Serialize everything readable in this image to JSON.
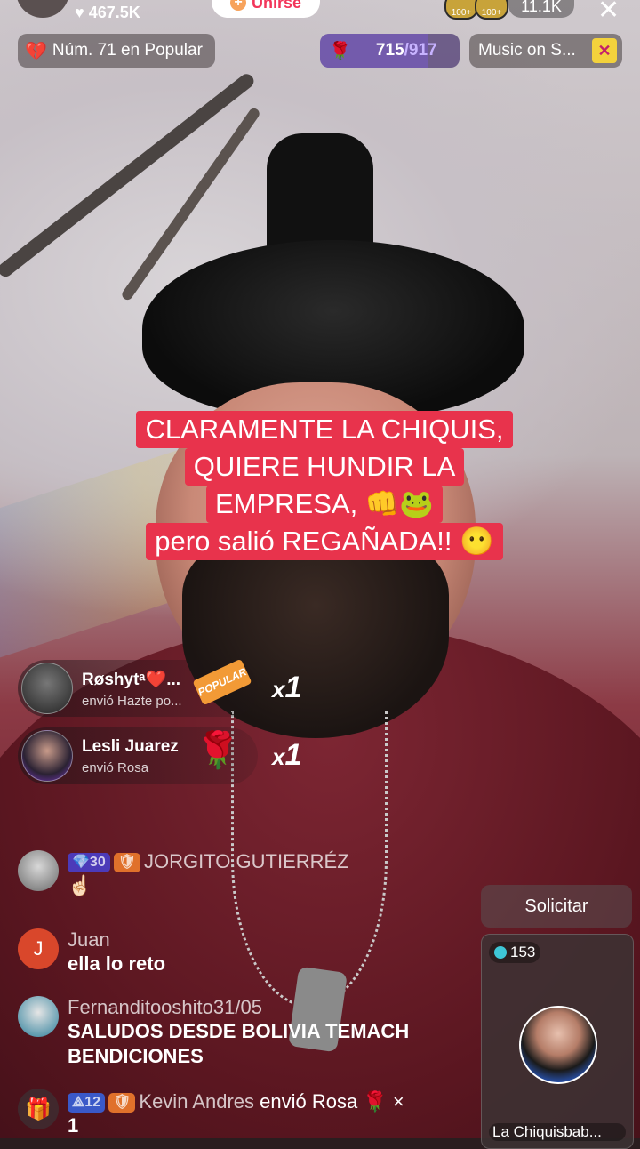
{
  "top": {
    "likes": "467.5K",
    "join_label": "Unirse",
    "badge_1": "100+",
    "badge_2": "100+",
    "viewers": "11.1K",
    "close_glyph": "✕"
  },
  "pills": {
    "rank_label": "Núm. 71 en Popular",
    "goal_current": "715",
    "goal_separator": "/",
    "goal_target": "917",
    "goal_progress": 0.78,
    "music_label": "Music on S...",
    "rank_icon": "broken-heart-icon",
    "goal_icon": "rose-icon",
    "music_icon": "gift-box-icon"
  },
  "caption": {
    "line1": "CLARAMENTE LA CHIQUIS,",
    "line2": "QUIERE HUNDIR LA",
    "line3": "EMPRESA, 👊🐸",
    "line4": "pero salió REGAÑADA!!  😶"
  },
  "gifts": [
    {
      "name": "Røshytᵃ❤️...",
      "sub": "envió Hazte po...",
      "gift_label": "POPULAR",
      "mult_prefix": "x",
      "mult": "1"
    },
    {
      "name": "Lesli Juarez",
      "sub": "envió Rosa",
      "gift_glyph": "🌹",
      "mult_prefix": "x",
      "mult": "1"
    }
  ],
  "chat": [
    {
      "name": "JORGITO GUTIERRÉZ",
      "badge1": "💎30",
      "badge2": "🛡",
      "msg": "☝🏻"
    },
    {
      "name": "Juan",
      "initial": "J",
      "msg": "ella lo reto"
    },
    {
      "name": "Fernanditooshito31/05",
      "msg": "SALUDOS DESDE BOLIVIA TEMACH BENDICIONES"
    },
    {
      "name": "Kevin Andres",
      "badge1": "⟁12",
      "badge2": "🛡",
      "msg": "envió Rosa 🌹 ×",
      "msg2": "1"
    }
  ],
  "guest": {
    "request_label": "Solicitar",
    "score": "153",
    "name": "La Chiquisbab..."
  },
  "colors": {
    "caption_bg": "#e8334c",
    "join_text": "#f2365a",
    "goal_bg": "#4c3ab9"
  }
}
